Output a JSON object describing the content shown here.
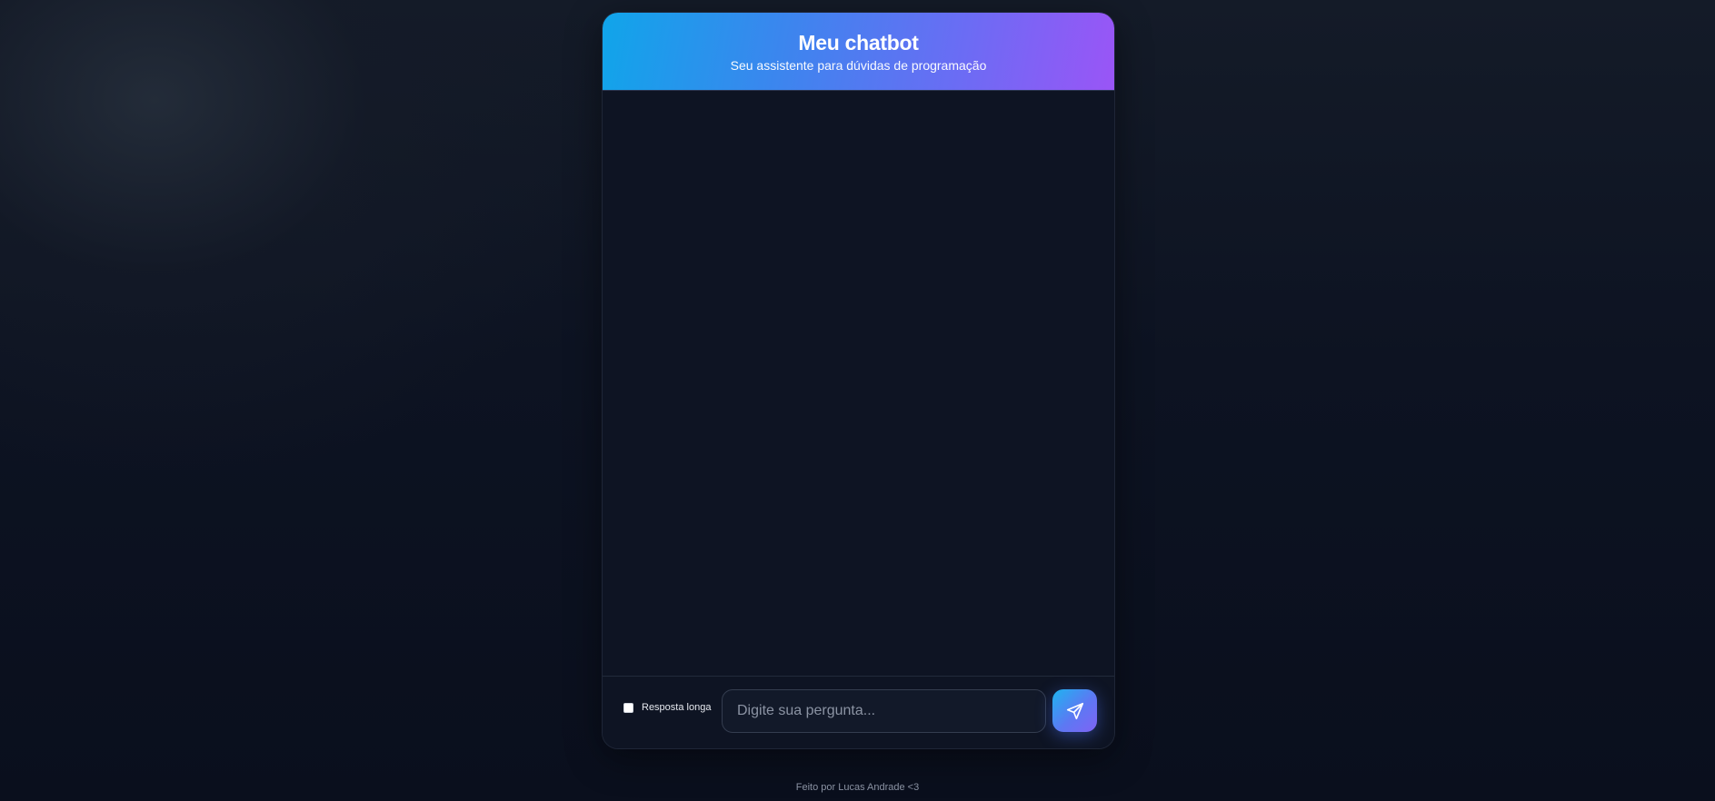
{
  "header": {
    "title": "Meu chatbot",
    "subtitle": "Seu assistente para dúvidas de programação"
  },
  "messages": [],
  "composer": {
    "long_answer_label": "Resposta longa",
    "long_answer_checked": false,
    "input_value": "",
    "input_placeholder": "Digite sua pergunta...",
    "send_icon": "send-paper-plane-icon"
  },
  "footer": {
    "credit": "Feito por Lucas Andrade <3"
  },
  "colors": {
    "header_gradient_start": "#10a5ea",
    "header_gradient_end": "#9a55f6",
    "background": "#0b111f",
    "card_background": "#0f1524"
  }
}
